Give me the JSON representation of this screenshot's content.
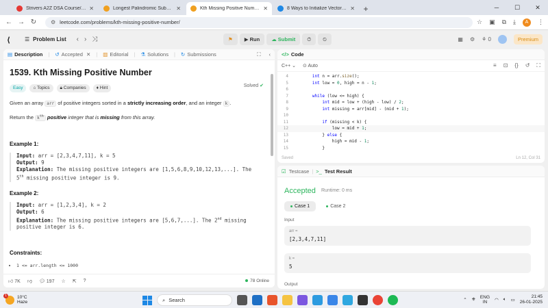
{
  "browser": {
    "tabs": [
      {
        "label": "Strivers A2Z DSA Course/Sheet",
        "color": "#e53935",
        "active": false
      },
      {
        "label": "Longest Palindromic Substring",
        "color": "#f0a020",
        "active": false
      },
      {
        "label": "Kth Missing Positive Number -",
        "color": "#f0a020",
        "active": true
      },
      {
        "label": "8 Ways to Initialize Vector in C++",
        "color": "#1e88e5",
        "active": false
      }
    ],
    "url": "leetcode.com/problems/kth-missing-positive-number/",
    "profile_initial": "A"
  },
  "header": {
    "problem_list": "Problem List",
    "run": "Run",
    "submit": "Submit",
    "streak": "0",
    "premium": "Premium"
  },
  "left": {
    "tabs": [
      "Description",
      "Accepted",
      "Editorial",
      "Solutions",
      "Submissions"
    ],
    "title": "1539. Kth Missing Positive Number",
    "solved": "Solved",
    "tags": [
      "Easy",
      "Topics",
      "Companies",
      "Hint"
    ],
    "desc1_a": "Given an array ",
    "desc1_code": "arr",
    "desc1_b": " of positive integers sorted in a ",
    "desc1_bold": "strictly increasing order",
    "desc1_c": ", and an integer ",
    "desc1_code2": "k",
    "desc1_d": ".",
    "desc2_a": "Return the ",
    "desc2_code": "k",
    "desc2_sup": "th",
    "desc2_bold": "positive",
    "desc2_b": " integer that is ",
    "desc2_bold2": "missing",
    "desc2_c": " from this array.",
    "ex1_title": "Example 1:",
    "ex1_input_label": "Input:",
    "ex1_input": " arr = [2,3,4,7,11], k = 5",
    "ex1_output_label": "Output:",
    "ex1_output": " 9",
    "ex1_expl_label": "Explanation:",
    "ex1_expl_a": " The missing positive integers are [1,5,6,8,9,10,12,13,...]. The",
    "ex1_expl_b_pre": "5",
    "ex1_expl_b_sup": "th",
    "ex1_expl_b": " missing positive integer is 9.",
    "ex2_title": "Example 2:",
    "ex2_input_label": "Input:",
    "ex2_input": " arr = [1,2,3,4], k = 2",
    "ex2_output_label": "Output:",
    "ex2_output": " 6",
    "ex2_expl_label": "Explanation:",
    "ex2_expl_a": " The missing positive integers are [5,6,7,...]. The 2",
    "ex2_expl_sup": "nd",
    "ex2_expl_b": " missing",
    "ex2_expl_c": "positive integer is 6.",
    "constraints_title": "Constraints:",
    "constraint1": "1 <= arr.length <= 1000",
    "footer": {
      "likes": "7K",
      "comments": "197",
      "online": "78 Online"
    }
  },
  "code": {
    "title": "Code",
    "lang": "C++",
    "mode": "Auto",
    "lines": [
      {
        "n": "4",
        "t": "        int n = arr.size();"
      },
      {
        "n": "5",
        "t": "        int low = 0, high = n - 1;"
      },
      {
        "n": "6",
        "t": ""
      },
      {
        "n": "7",
        "t": "        while (low <= high) {"
      },
      {
        "n": "8",
        "t": "            int mid = low + (high - low) / 2;"
      },
      {
        "n": "9",
        "t": "            int missing = arr[mid] - (mid + 1);"
      },
      {
        "n": "10",
        "t": ""
      },
      {
        "n": "11",
        "t": "            if (missing < k) {"
      },
      {
        "n": "12",
        "t": "                low = mid + 1;"
      },
      {
        "n": "13",
        "t": "            } else {"
      },
      {
        "n": "14",
        "t": "                high = mid - 1;"
      },
      {
        "n": "15",
        "t": "            }"
      }
    ],
    "saved": "Saved",
    "position": "Ln 12, Col 31"
  },
  "test": {
    "tab_testcase": "Testcase",
    "tab_result": "Test Result",
    "status": "Accepted",
    "runtime": "Runtime: 0 ms",
    "case1": "Case 1",
    "case2": "Case 2",
    "input_label": "Input",
    "arr_label": "arr =",
    "arr_value": "[2,3,4,7,11]",
    "k_label": "k =",
    "k_value": "5",
    "output_label": "Output"
  },
  "taskbar": {
    "temp": "10°C",
    "weather": "Haze",
    "badge": "1",
    "search": "Search",
    "lang1": "ENG",
    "lang2": "IN",
    "time": "21:45",
    "date": "26-01-2025"
  }
}
